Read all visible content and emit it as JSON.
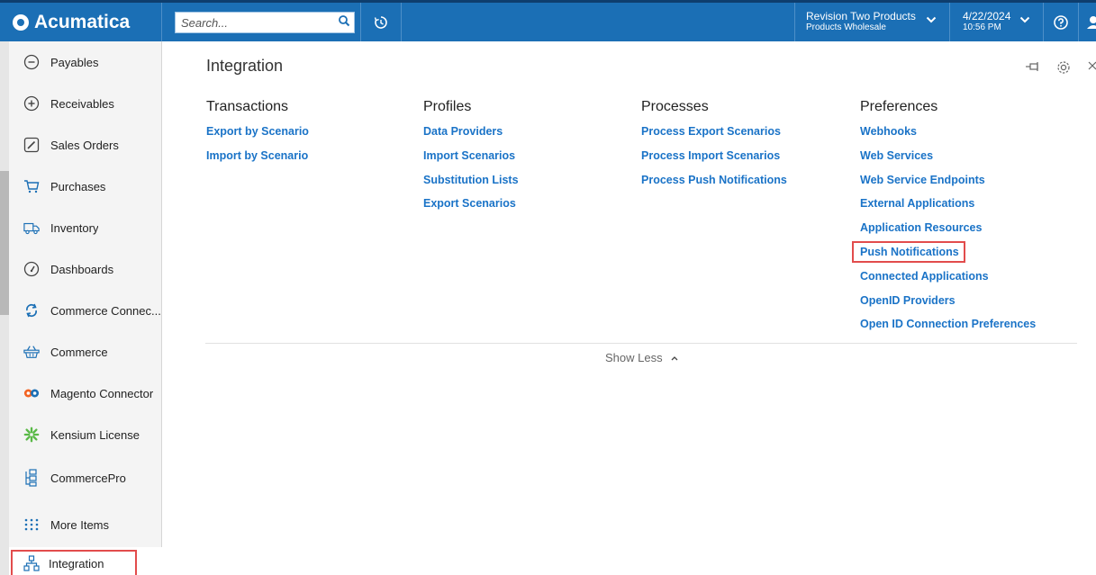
{
  "app": {
    "logo_text": "Acumatica",
    "brand_color": "#1b6fb5",
    "accent_color": "#1a73c7",
    "highlight_color": "#e24c4c"
  },
  "topbar": {
    "search_placeholder": "Search...",
    "company_name": "Revision Two Products",
    "company_branch": "Products Wholesale",
    "date": "4/22/2024",
    "time": "10:56 PM"
  },
  "sidebar": {
    "items": [
      {
        "label": "Payables",
        "icon": "minus-circle-icon"
      },
      {
        "label": "Receivables",
        "icon": "plus-circle-icon"
      },
      {
        "label": "Sales Orders",
        "icon": "pencil-square-icon"
      },
      {
        "label": "Purchases",
        "icon": "cart-icon"
      },
      {
        "label": "Inventory",
        "icon": "truck-icon"
      },
      {
        "label": "Dashboards",
        "icon": "gauge-icon"
      },
      {
        "label": "Commerce Connec...",
        "icon": "sync-icon"
      },
      {
        "label": "Commerce",
        "icon": "basket-icon"
      },
      {
        "label": "Magento Connector",
        "icon": "magento-logo-icon"
      },
      {
        "label": "Kensium License",
        "icon": "kensium-logo-icon"
      },
      {
        "label": "CommercePro",
        "icon": "hierarchy-icon"
      },
      {
        "label": "More Items",
        "icon": "grid-dots-icon"
      }
    ],
    "active_item": {
      "label": "Integration",
      "icon": "integration-icon"
    }
  },
  "main": {
    "title": "Integration",
    "columns": [
      {
        "header": "Transactions",
        "links": [
          "Export by Scenario",
          "Import by Scenario"
        ]
      },
      {
        "header": "Profiles",
        "links": [
          "Data Providers",
          "Import Scenarios",
          "Substitution Lists",
          "Export Scenarios"
        ]
      },
      {
        "header": "Processes",
        "links": [
          "Process Export Scenarios",
          "Process Import Scenarios",
          "Process Push Notifications"
        ]
      },
      {
        "header": "Preferences",
        "links": [
          "Webhooks",
          "Web Services",
          "Web Service Endpoints",
          "External Applications",
          "Application Resources",
          "Push Notifications",
          "Connected Applications",
          "OpenID Providers",
          "Open ID Connection Preferences"
        ]
      }
    ],
    "highlighted_link": "Push Notifications",
    "show_less_label": "Show Less"
  }
}
